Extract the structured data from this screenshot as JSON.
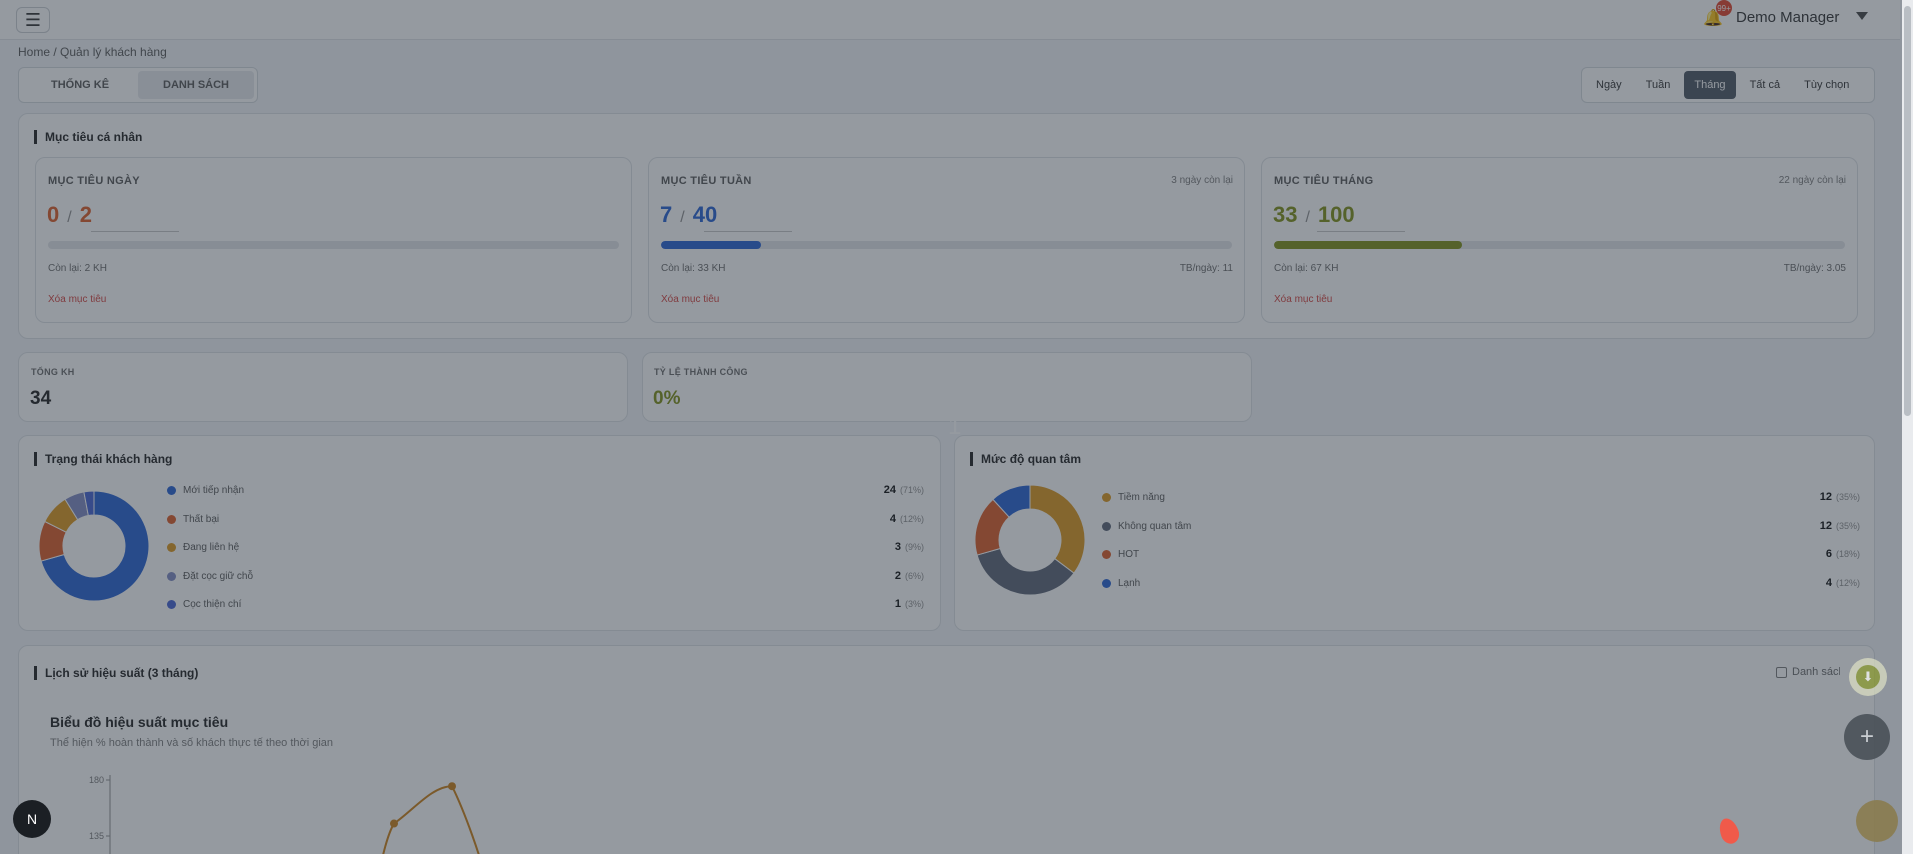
{
  "header": {
    "menu_icon": "hamburger-icon",
    "notification_count": "99+",
    "user_name": "Demo Manager"
  },
  "breadcrumb": "Home / Quản lý khách hàng",
  "view_tabs": [
    "THỐNG KÊ",
    "DANH SÁCH"
  ],
  "period_tabs": [
    "Ngày",
    "Tuần",
    "Tháng",
    "Tất cả",
    "Tùy chọn"
  ],
  "active_period": "Tháng",
  "personal_goals": {
    "title": "Mục tiêu cá nhân",
    "cards": [
      {
        "label": "MỤC TIÊU NGÀY",
        "note": "",
        "done": "0",
        "target": "2",
        "color": "#e06a3a",
        "progress": 0,
        "remaining": "Còn lại: 2 KH",
        "avg": "",
        "delete": "Xóa mục tiêu"
      },
      {
        "label": "MỤC TIÊU TUẦN",
        "note": "3 ngày còn lại",
        "done": "7",
        "target": "40",
        "color": "#3a6fd8",
        "progress": 0.175,
        "remaining": "Còn lại: 33 KH",
        "avg": "TB/ngày: 11",
        "delete": "Xóa mục tiêu"
      },
      {
        "label": "MỤC TIÊU THÁNG",
        "note": "22 ngày còn lại",
        "done": "33",
        "target": "100",
        "color": "#8a9a2a",
        "progress": 0.33,
        "remaining": "Còn lại: 67 KH",
        "avg": "TB/ngày: 3.05",
        "delete": "Xóa mục tiêu"
      }
    ]
  },
  "stats": [
    {
      "label": "TỔNG KH",
      "value": "34",
      "color": "#222222"
    },
    {
      "label": "TỶ LỆ THÀNH CÔNG",
      "value": "0%",
      "color": "#8a9a2a"
    }
  ],
  "page_indicator": "1",
  "customer_status": {
    "title": "Trạng thái khách hàng",
    "items": [
      {
        "label": "Mới tiếp nhận",
        "count": "24",
        "pct": "(71%)",
        "value": 24,
        "color": "#3a6fd8"
      },
      {
        "label": "Thất bại",
        "count": "4",
        "pct": "(12%)",
        "value": 4,
        "color": "#e06a3a"
      },
      {
        "label": "Đang liên hệ",
        "count": "3",
        "pct": "(9%)",
        "value": 3,
        "color": "#e0a030"
      },
      {
        "label": "Đặt cọc giữ chỗ",
        "count": "2",
        "pct": "(6%)",
        "value": 2,
        "color": "#8a94c8"
      },
      {
        "label": "Cọc thiện chí",
        "count": "1",
        "pct": "(3%)",
        "value": 1,
        "color": "#5570d8"
      }
    ]
  },
  "interest_level": {
    "title": "Mức độ quan tâm",
    "items": [
      {
        "label": "Tiềm năng",
        "count": "12",
        "pct": "(35%)",
        "value": 12,
        "color": "#e0a030"
      },
      {
        "label": "Không quan tâm",
        "count": "12",
        "pct": "(35%)",
        "value": 12,
        "color": "#6a7282"
      },
      {
        "label": "HOT",
        "count": "6",
        "pct": "(18%)",
        "value": 6,
        "color": "#e06a3a"
      },
      {
        "label": "Lạnh",
        "count": "4",
        "pct": "(12%)",
        "value": 4,
        "color": "#3a6fd8"
      }
    ]
  },
  "performance": {
    "title": "Lịch sử hiệu suất (3 tháng)",
    "toggle_label": "Danh sách",
    "chart_title": "Biểu đồ hiệu suất mục tiêu",
    "chart_subtitle": "Thể hiện % hoàn thành và số khách thực tế theo thời gian"
  },
  "chart_data": {
    "type": "line",
    "title": "Biểu đồ hiệu suất mục tiêu",
    "subtitle": "Thể hiện % hoàn thành và số khách thực tế theo thời gian",
    "y_ticks": [
      "180",
      "135"
    ],
    "ylim": [
      90,
      180
    ],
    "series": [
      {
        "x": [
          0,
          1,
          2,
          3,
          4
        ],
        "y": [
          90,
          145,
          175,
          178,
          90
        ],
        "color": "#d08a2a"
      }
    ]
  },
  "fab": {
    "download_icon": "download-icon",
    "add_icon": "plus-icon",
    "avatar_icon": "assistant-avatar-icon",
    "nextjs_badge": "N"
  }
}
